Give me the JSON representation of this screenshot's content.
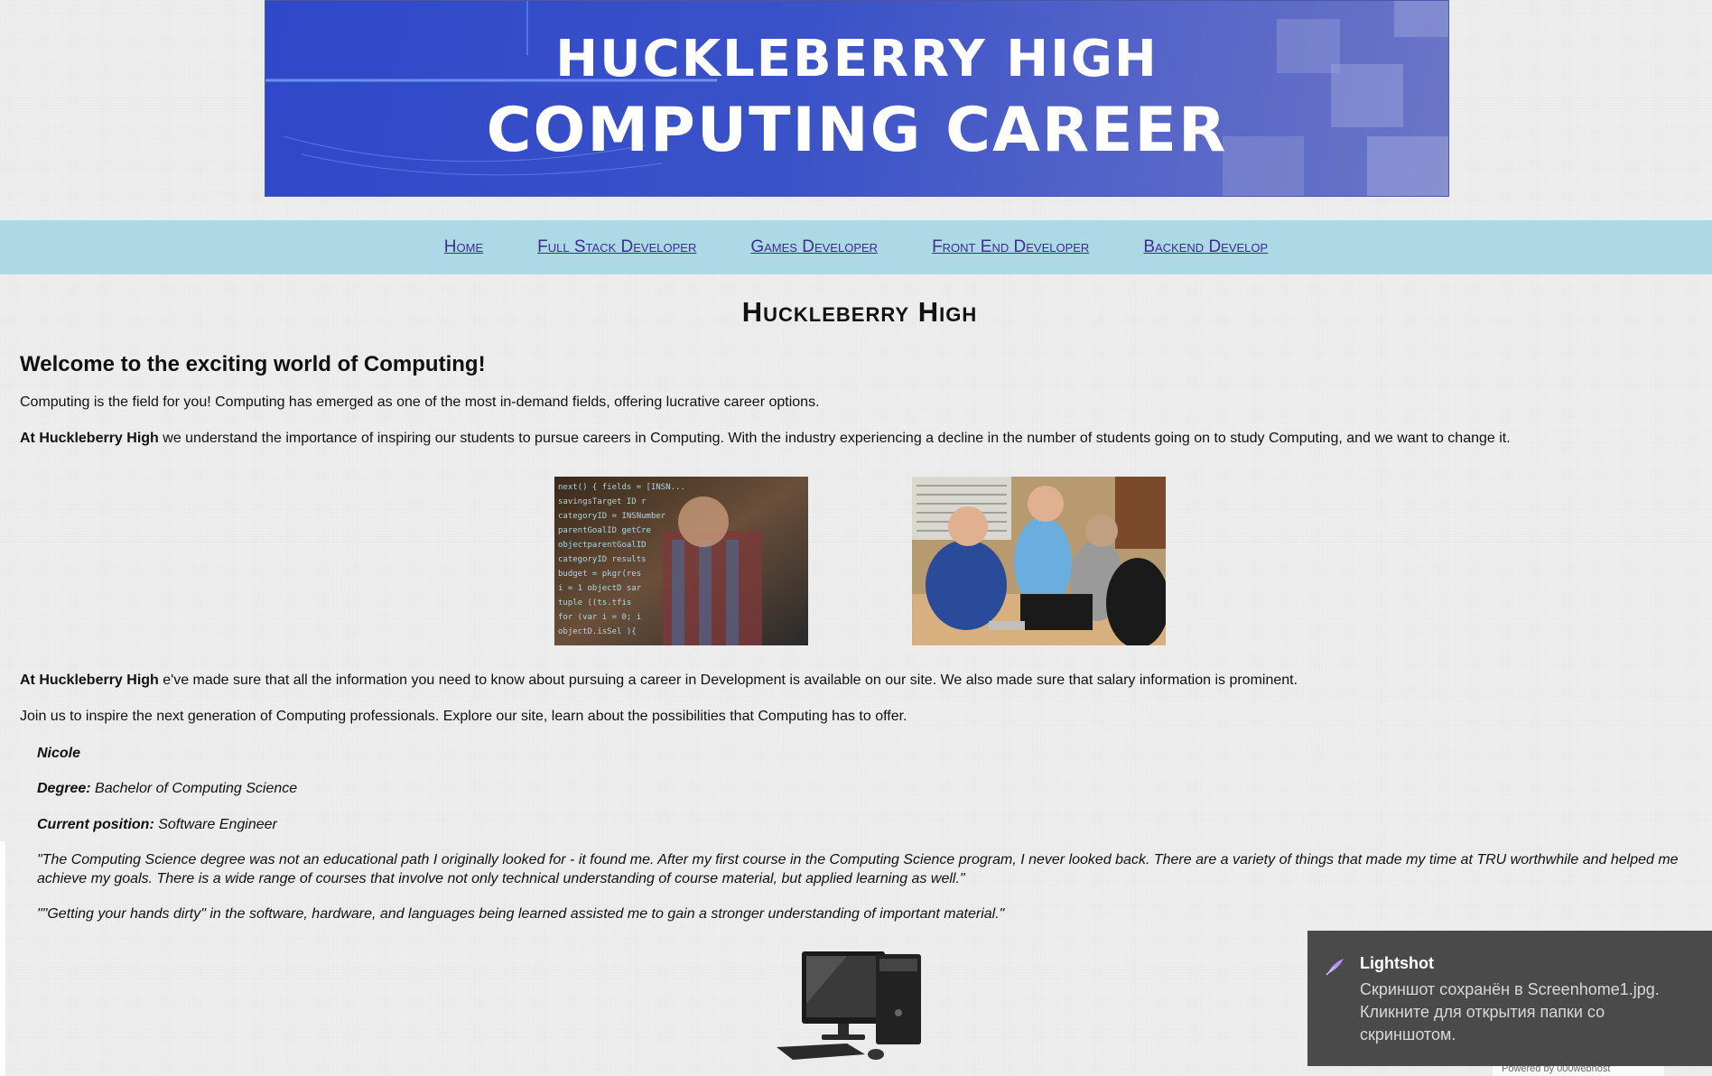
{
  "banner": {
    "line1": "HUCKLEBERRY HIGH",
    "line2": "COMPUTING CAREER"
  },
  "nav": {
    "items": [
      {
        "label": "Home"
      },
      {
        "label": "Full Stack Developer"
      },
      {
        "label": "Games Developer"
      },
      {
        "label": "Front End Developer"
      },
      {
        "label": "Backend Develop"
      }
    ]
  },
  "main": {
    "title": "Huckleberry High",
    "welcome": "Welcome to the exciting world of Computing!",
    "p1": "Computing is the field for you! Computing has emerged as one of the most in-demand fields, offering lucrative career options.",
    "p2_bold": "At Huckleberry High",
    "p2_rest": " we understand the importance of inspiring our students to pursue careers in Computing. With the industry experiencing a decline in the number of students going on to study Computing, and we want to change it.",
    "p3_bold": "At Huckleberry High",
    "p3_rest": " e've made sure that all the information you need to know about pursuing a career in Development is available on our site. We also made sure that salary information is prominent.",
    "p4": "Join us to inspire the next generation of Computing professionals. Explore our site, learn about the possibilities that Computing has to offer."
  },
  "testimonial": {
    "name": "Nicole",
    "degree_label": "Degree:",
    "degree": " Bachelor of Computing Science",
    "position_label": "Current position:",
    "position": " Software Engineer",
    "quote1": "\"The Computing Science degree was not an educational path I originally looked for - it found me. After my first course in the Computing Science program, I never looked back. There are a variety of things that made my time at TRU worthwhile and helped me achieve my goals. There is a wide range of courses that involve not only technical understanding of course material, but applied learning as well.\"",
    "quote2": "\"\"Getting your hands dirty\" in the software, hardware, and languages being learned assisted me to gain a stronger understanding of important material.\""
  },
  "toast": {
    "app": "Lightshot",
    "message": "Скриншот сохранён в Screenhome1.jpg. Кликните для открытия папки со скриншотом.",
    "icon": "feather-icon"
  },
  "footer": {
    "hosting": "Powered by  000webhost"
  },
  "colors": {
    "nav_bg": "#add8e6",
    "nav_link": "#3a2f8a",
    "banner_blue": "#3a52c8",
    "toast_bg": "#4a4a4a"
  }
}
